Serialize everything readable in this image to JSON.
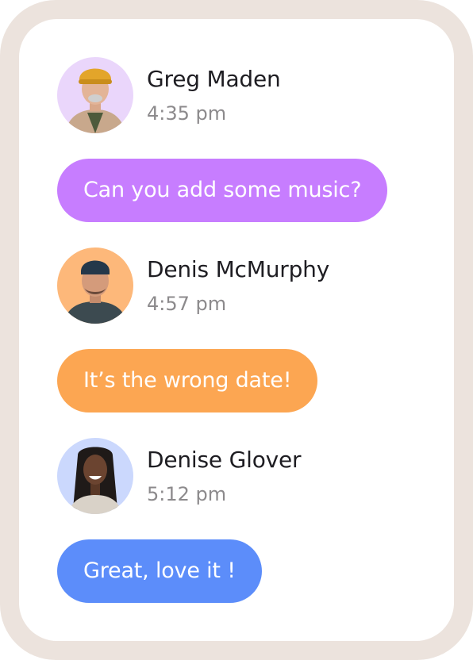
{
  "colors": {
    "frame": "#ece3dd",
    "card": "#ffffff",
    "name_text": "#1e1d22",
    "time_text": "#8c8a8c"
  },
  "messages": [
    {
      "sender": "Greg Maden",
      "time": "4:35 pm",
      "text": "Can you add some music?",
      "bubble_color": "#c77dff",
      "avatar_bg": "#ead6fb",
      "avatar_icon": "person-avatar-icon"
    },
    {
      "sender": "Denis McMurphy",
      "time": "4:57 pm",
      "text": "It’s the wrong date!",
      "bubble_color": "#fca652",
      "avatar_bg": "#fdb87a",
      "avatar_icon": "person-avatar-icon"
    },
    {
      "sender": "Denise Glover",
      "time": "5:12 pm",
      "text": "Great, love it !",
      "bubble_color": "#5c8dfa",
      "avatar_bg": "#cbd8fd",
      "avatar_icon": "person-avatar-icon"
    }
  ]
}
